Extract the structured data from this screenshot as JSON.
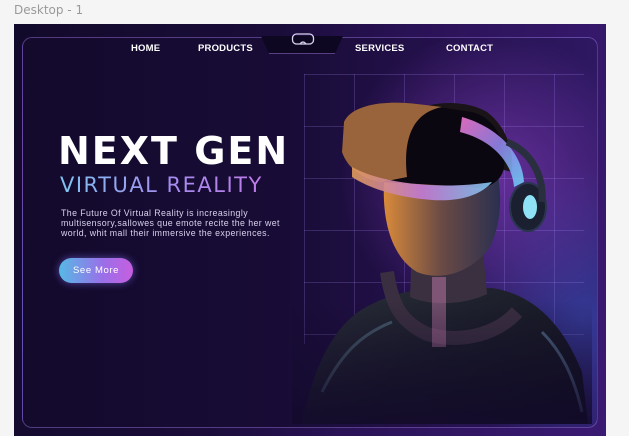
{
  "canvas": {
    "frame_label": "Desktop - 1"
  },
  "nav": {
    "links": [
      {
        "label": "HOME"
      },
      {
        "label": "PRODUCTS"
      },
      {
        "label": "SERVICES"
      },
      {
        "label": "CONTACT"
      }
    ],
    "logo_icon": "vr-headset-icon"
  },
  "hero": {
    "title": "NEXT GEN",
    "subtitle": "VIRTUAL REALITY",
    "description": "The Future Of Virtual Reality is increasingly multisensory,sallowes que emote recite the her wet world, whit mall their immersive the experiences.",
    "cta_label": "See More",
    "image_subject": "person-wearing-vr-headset"
  },
  "colors": {
    "background": "#1a0d3a",
    "accent_start": "#56b9e6",
    "accent_end": "#c65fe0",
    "text": "#ffffff"
  }
}
